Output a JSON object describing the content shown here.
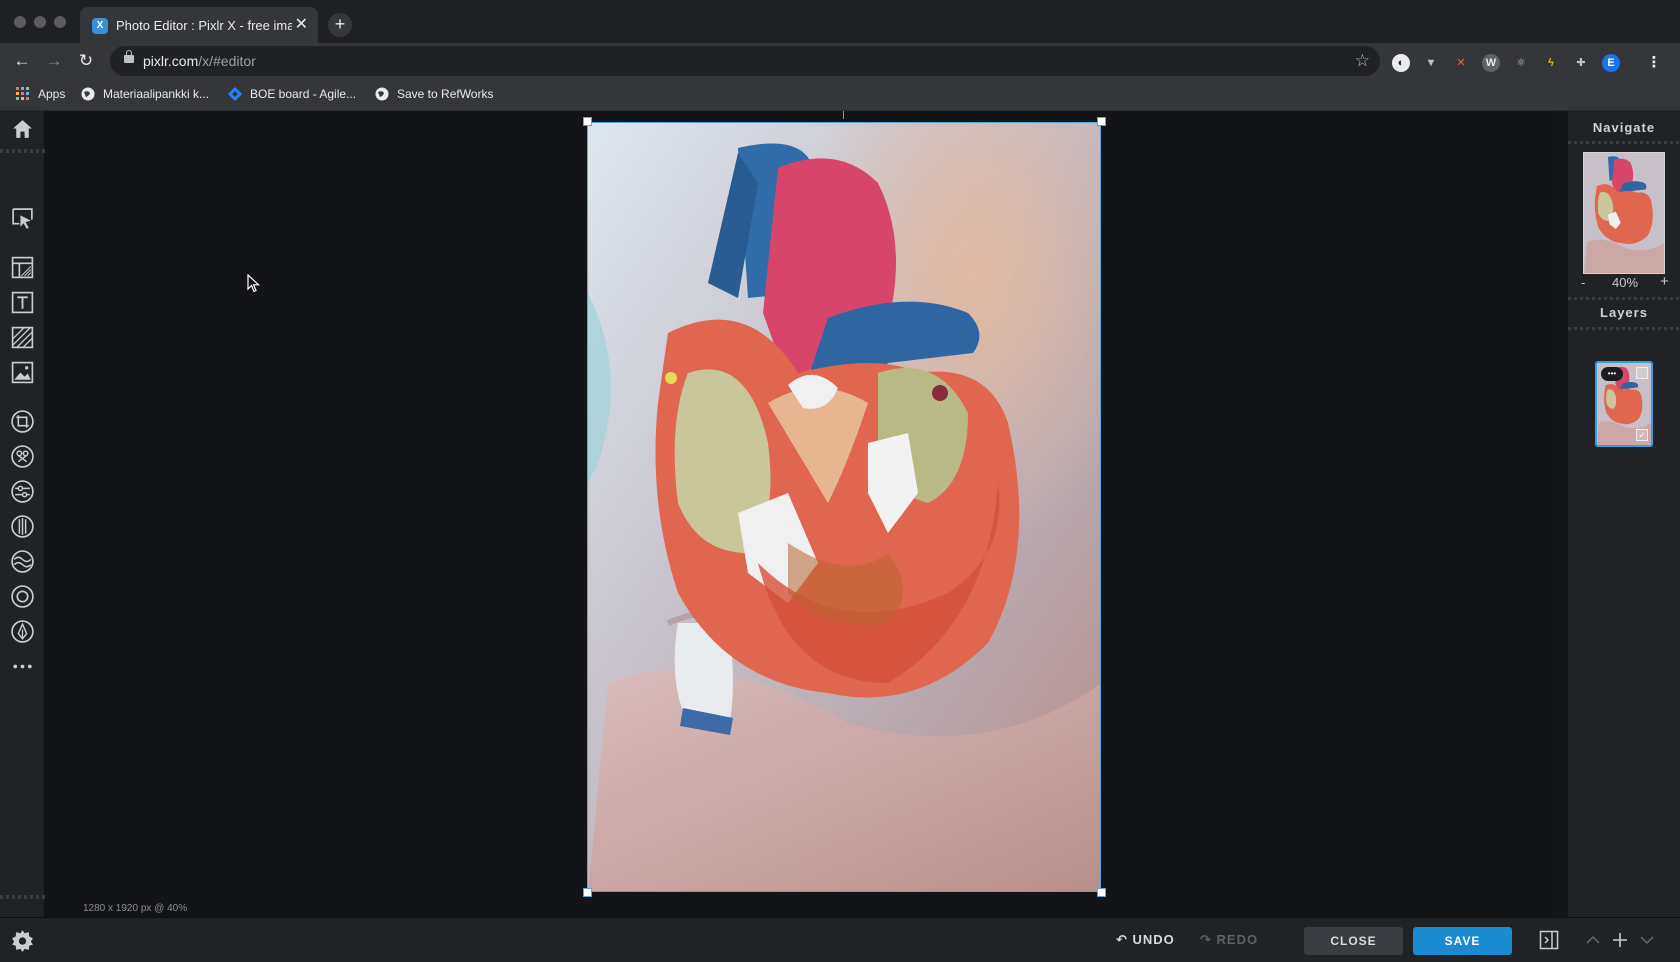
{
  "browser": {
    "tab_title": "Photo Editor : Pixlr X - free ima",
    "tab_close": "✕",
    "new_tab": "+",
    "url_host": "pixlr.com",
    "url_path": "/x/#editor",
    "avatar_letter": "E",
    "bookmarks": [
      "Apps",
      "Materiaalipankki k...",
      "BOE board - Agile...",
      "Save to RefWorks"
    ]
  },
  "editor": {
    "status": "1280 x 1920 px @ 40%",
    "undo_label": "UNDO",
    "redo_label": "REDO",
    "close_label": "CLOSE",
    "save_label": "SAVE",
    "navigate_title": "Navigate",
    "zoom_minus": "-",
    "zoom_value": "40%",
    "zoom_plus": "+",
    "layers_title": "Layers",
    "more_dots": "•••"
  },
  "colors": {
    "accent": "#1a8ad1",
    "selection": "#5aa7d6"
  }
}
